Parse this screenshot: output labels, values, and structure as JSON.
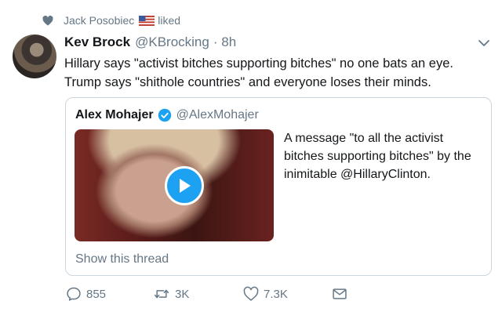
{
  "social_context": {
    "user": "Jack Posobiec",
    "action": "liked",
    "flag_icon": "us-flag-icon"
  },
  "tweet": {
    "author_name": "Kev Brock",
    "author_handle": "@KBrocking",
    "time": "· 8h",
    "lines": [
      "Hillary says \"activist bitches supporting bitches\" no one bats an eye.",
      "Trump says \"shithole countries\" and everyone loses their minds."
    ]
  },
  "quoted_tweet": {
    "author_name": "Alex Mohajer",
    "author_handle": "@AlexMohajer",
    "verified": true,
    "lines": [
      "A message \"to all the activist",
      "bitches supporting bitches\" by the",
      "inimitable @HillaryClinton."
    ],
    "show_thread": "Show this thread"
  },
  "actions": {
    "replies": "855",
    "retweets": "3K",
    "likes": "7.3K"
  },
  "colors": {
    "accent": "#1da1f2",
    "muted": "#657786",
    "border": "#ccd6dd"
  }
}
